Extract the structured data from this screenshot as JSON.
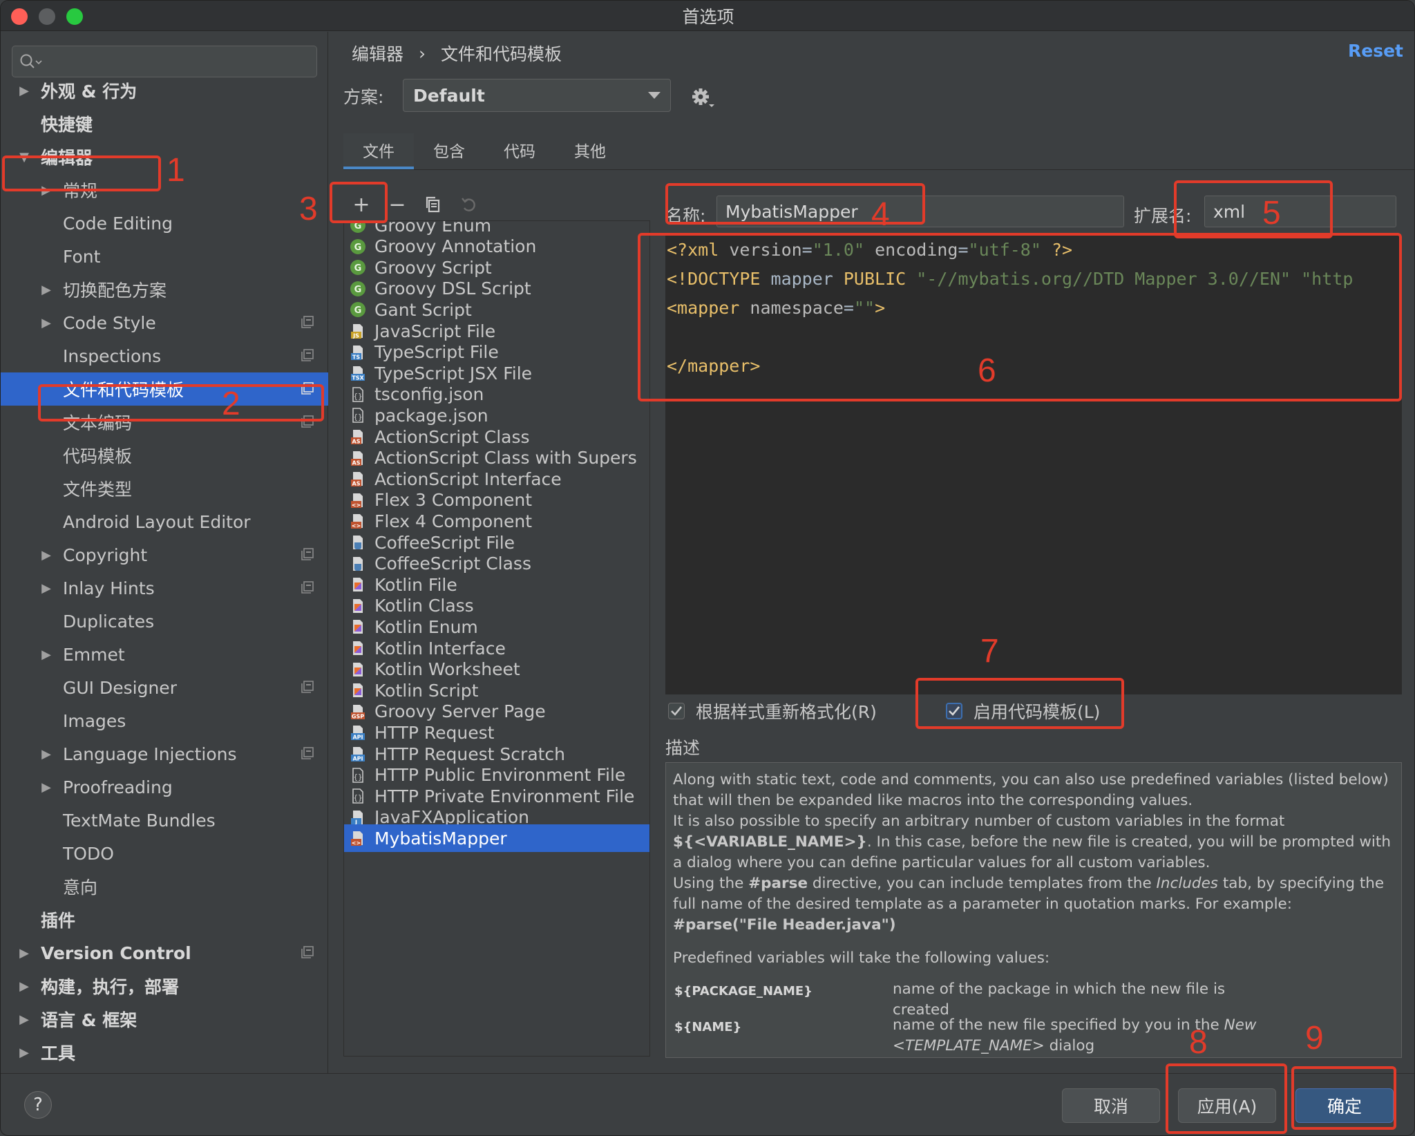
{
  "window": {
    "title": "首选项"
  },
  "search": {
    "placeholder": ""
  },
  "tree": [
    {
      "label": "外观 & 行为",
      "arrow": "▶",
      "bold": true
    },
    {
      "label": "快捷键",
      "bold": true
    },
    {
      "label": "编辑器",
      "arrow": "▼",
      "bold": true
    },
    {
      "label": "常规",
      "arrow": "▶"
    },
    {
      "label": "Code Editing"
    },
    {
      "label": "Font"
    },
    {
      "label": "切换配色方案",
      "arrow": "▶"
    },
    {
      "label": "Code Style",
      "arrow": "▶",
      "proj": true
    },
    {
      "label": "Inspections",
      "proj": true
    },
    {
      "label": "文件和代码模板",
      "selected": true,
      "proj": true
    },
    {
      "label": "文本编码",
      "proj": true
    },
    {
      "label": "代码模板"
    },
    {
      "label": "文件类型"
    },
    {
      "label": "Android Layout Editor"
    },
    {
      "label": "Copyright",
      "arrow": "▶",
      "proj": true
    },
    {
      "label": "Inlay Hints",
      "arrow": "▶",
      "proj": true
    },
    {
      "label": "Duplicates"
    },
    {
      "label": "Emmet",
      "arrow": "▶"
    },
    {
      "label": "GUI Designer",
      "proj": true
    },
    {
      "label": "Images"
    },
    {
      "label": "Language Injections",
      "arrow": "▶",
      "proj": true
    },
    {
      "label": "Proofreading",
      "arrow": "▶"
    },
    {
      "label": "TextMate Bundles"
    },
    {
      "label": "TODO"
    },
    {
      "label": "意向"
    },
    {
      "label": "插件",
      "bold": true
    },
    {
      "label": "Version Control",
      "arrow": "▶",
      "bold": true,
      "proj": true
    },
    {
      "label": "构建，执行，部署",
      "arrow": "▶",
      "bold": true
    },
    {
      "label": "语言 & 框架",
      "arrow": "▶",
      "bold": true
    },
    {
      "label": "工具",
      "arrow": "▶",
      "bold": true
    }
  ],
  "breadcrumb": {
    "parent": "编辑器",
    "sep": "›",
    "current": "文件和代码模板"
  },
  "reset_label": "Reset",
  "scheme": {
    "label": "方案:",
    "value": "Default"
  },
  "tabs": [
    "文件",
    "包含",
    "代码",
    "其他"
  ],
  "toolbar": {
    "add": "+",
    "remove": "−"
  },
  "templates": [
    {
      "name": "Groovy Enum",
      "icon": "groovy"
    },
    {
      "name": "Groovy Annotation",
      "icon": "groovy"
    },
    {
      "name": "Groovy Script",
      "icon": "groovy"
    },
    {
      "name": "Groovy DSL Script",
      "icon": "groovy"
    },
    {
      "name": "Gant Script",
      "icon": "groovy"
    },
    {
      "name": "JavaScript File",
      "icon": "js",
      "tag": "JS"
    },
    {
      "name": "TypeScript File",
      "icon": "ts",
      "tag": "TS"
    },
    {
      "name": "TypeScript JSX File",
      "icon": "ts",
      "tag": "TSX"
    },
    {
      "name": "tsconfig.json",
      "icon": "json"
    },
    {
      "name": "package.json",
      "icon": "json"
    },
    {
      "name": "ActionScript Class",
      "icon": "as",
      "tag": "AS"
    },
    {
      "name": "ActionScript Class with Supers",
      "icon": "as",
      "tag": "AS"
    },
    {
      "name": "ActionScript Interface",
      "icon": "as",
      "tag": "AS"
    },
    {
      "name": "Flex 3 Component",
      "icon": "flex",
      "tag": "<>"
    },
    {
      "name": "Flex 4 Component",
      "icon": "flex",
      "tag": "<>"
    },
    {
      "name": "CoffeeScript File",
      "icon": "coffee"
    },
    {
      "name": "CoffeeScript Class",
      "icon": "coffee"
    },
    {
      "name": "Kotlin File",
      "icon": "kotlin"
    },
    {
      "name": "Kotlin Class",
      "icon": "kotlin"
    },
    {
      "name": "Kotlin Enum",
      "icon": "kotlin"
    },
    {
      "name": "Kotlin Interface",
      "icon": "kotlin"
    },
    {
      "name": "Kotlin Worksheet",
      "icon": "kotlin"
    },
    {
      "name": "Kotlin Script",
      "icon": "kotlin"
    },
    {
      "name": "Groovy Server Page",
      "icon": "gsp",
      "tag": "GSP"
    },
    {
      "name": "HTTP Request",
      "icon": "api",
      "tag": "API"
    },
    {
      "name": "HTTP Request Scratch",
      "icon": "api",
      "tag": "API"
    },
    {
      "name": "HTTP Public Environment File",
      "icon": "json"
    },
    {
      "name": "HTTP Private Environment File",
      "icon": "json"
    },
    {
      "name": "JavaFXApplication",
      "icon": "java",
      "tag": "J"
    },
    {
      "name": "MybatisMapper",
      "icon": "flex",
      "tag": "<>",
      "selected": true
    }
  ],
  "name_field": {
    "label": "名称:",
    "value": "MybatisMapper"
  },
  "ext_field": {
    "label": "扩展名:",
    "value": "xml"
  },
  "code": {
    "line1": [
      [
        "kw",
        "<?xml "
      ],
      [
        "at",
        "version"
      ],
      [
        "pl",
        "="
      ],
      [
        "st",
        "\"1.0\""
      ],
      [
        "pl",
        " "
      ],
      [
        "at",
        "encoding"
      ],
      [
        "pl",
        "="
      ],
      [
        "st",
        "\"utf-8\""
      ],
      [
        "kw",
        " ?>"
      ]
    ],
    "line2": [
      [
        "kw",
        "<!DOCTYPE "
      ],
      [
        "pl",
        "mapper "
      ],
      [
        "kw",
        "PUBLIC "
      ],
      [
        "st",
        "\"-//mybatis.org//DTD Mapper 3.0//EN\" \"http"
      ]
    ],
    "line3": [
      [
        "kw",
        "<mapper "
      ],
      [
        "at",
        "namespace"
      ],
      [
        "pl",
        "="
      ],
      [
        "st",
        "\"\""
      ],
      [
        "kw",
        ">"
      ]
    ],
    "line4": [],
    "line5": [
      [
        "kw",
        "</mapper>"
      ]
    ]
  },
  "options": {
    "reformat": "根据样式重新格式化(R)",
    "enable_live": "启用代码模板(L)"
  },
  "description": {
    "label": "描述",
    "p1": "Along with static text, code and comments, you can also use predefined variables (listed below) that will then be expanded like macros into the corresponding values.",
    "p2a": "It is also possible to specify an arbitrary number of custom variables in the format ",
    "p2b": "${<VARIABLE_NAME>}",
    "p2c": ". In this case, before the new file is created, you will be prompted with a dialog where you can define particular values for all custom variables.",
    "p3a": "Using the ",
    "p3b": "#parse",
    "p3c": " directive, you can include templates from the ",
    "p3d": "Includes",
    "p3e": " tab, by specifying the full name of the desired template as a parameter in quotation marks. For example:",
    "p3f": "#parse(\"File Header.java\")",
    "p4": "Predefined variables will take the following values:",
    "var1": "${PACKAGE_NAME}",
    "var1_desc": "name of the package in which the new file is created",
    "var2": "${NAME}",
    "var2_desc_a": "name of the new file specified by you in the ",
    "var2_desc_b": "New <TEMPLATE_NAME>",
    "var2_desc_c": " dialog"
  },
  "footer": {
    "help": "?",
    "cancel": "取消",
    "apply": "应用(A)",
    "ok": "确定"
  },
  "annotations": [
    "1",
    "2",
    "3",
    "4",
    "5",
    "6",
    "7",
    "8",
    "9"
  ],
  "colors": {
    "accent": "#2f65ca",
    "annotation": "#e23b2a",
    "link": "#589df6"
  }
}
